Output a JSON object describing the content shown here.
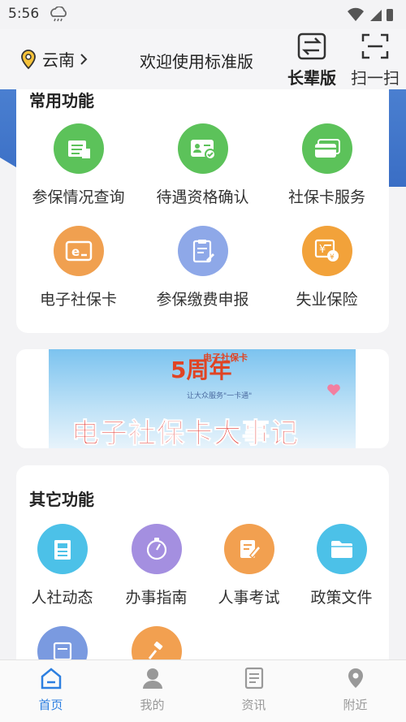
{
  "status": {
    "time": "5:56"
  },
  "header": {
    "location": "云南",
    "welcome": "欢迎使用标准版",
    "elder_label": "长辈版",
    "scan_label": "扫一扫"
  },
  "common": {
    "title": "常用功能",
    "items": [
      {
        "label": "参保情况查询",
        "icon": "document-list-icon",
        "color": "#5cc25a"
      },
      {
        "label": "待遇资格确认",
        "icon": "id-card-check-icon",
        "color": "#5cc25a"
      },
      {
        "label": "社保卡服务",
        "icon": "card-icon",
        "color": "#5cc25a"
      },
      {
        "label": "电子社保卡",
        "icon": "e-card-icon",
        "color": "#f0a050"
      },
      {
        "label": "参保缴费申报",
        "icon": "clipboard-edit-icon",
        "color": "#8ea8e8"
      },
      {
        "label": "失业保险",
        "icon": "money-icon",
        "color": "#f2a23a"
      }
    ]
  },
  "banner": {
    "top_text": "电子社保卡",
    "year_text": "5周年",
    "sub_text": "让大众服务\"一卡通\"",
    "headline": "电子社保卡大事记"
  },
  "other": {
    "title": "其它功能",
    "items": [
      {
        "label": "人社动态",
        "icon": "news-icon",
        "color": "#4cc1e8"
      },
      {
        "label": "办事指南",
        "icon": "compass-icon",
        "color": "#a48fe0"
      },
      {
        "label": "人事考试",
        "icon": "edit-icon",
        "color": "#f2a050"
      },
      {
        "label": "政策文件",
        "icon": "folder-icon",
        "color": "#4cc1e8"
      }
    ]
  },
  "tabs": [
    {
      "label": "首页",
      "icon": "home-icon",
      "active": true
    },
    {
      "label": "我的",
      "icon": "user-icon",
      "active": false
    },
    {
      "label": "资讯",
      "icon": "news-icon",
      "active": false
    },
    {
      "label": "附近",
      "icon": "location-pin-icon",
      "active": false
    }
  ],
  "colors": {
    "accent": "#2d7fe0",
    "header_blue": "#3a6ec5"
  }
}
